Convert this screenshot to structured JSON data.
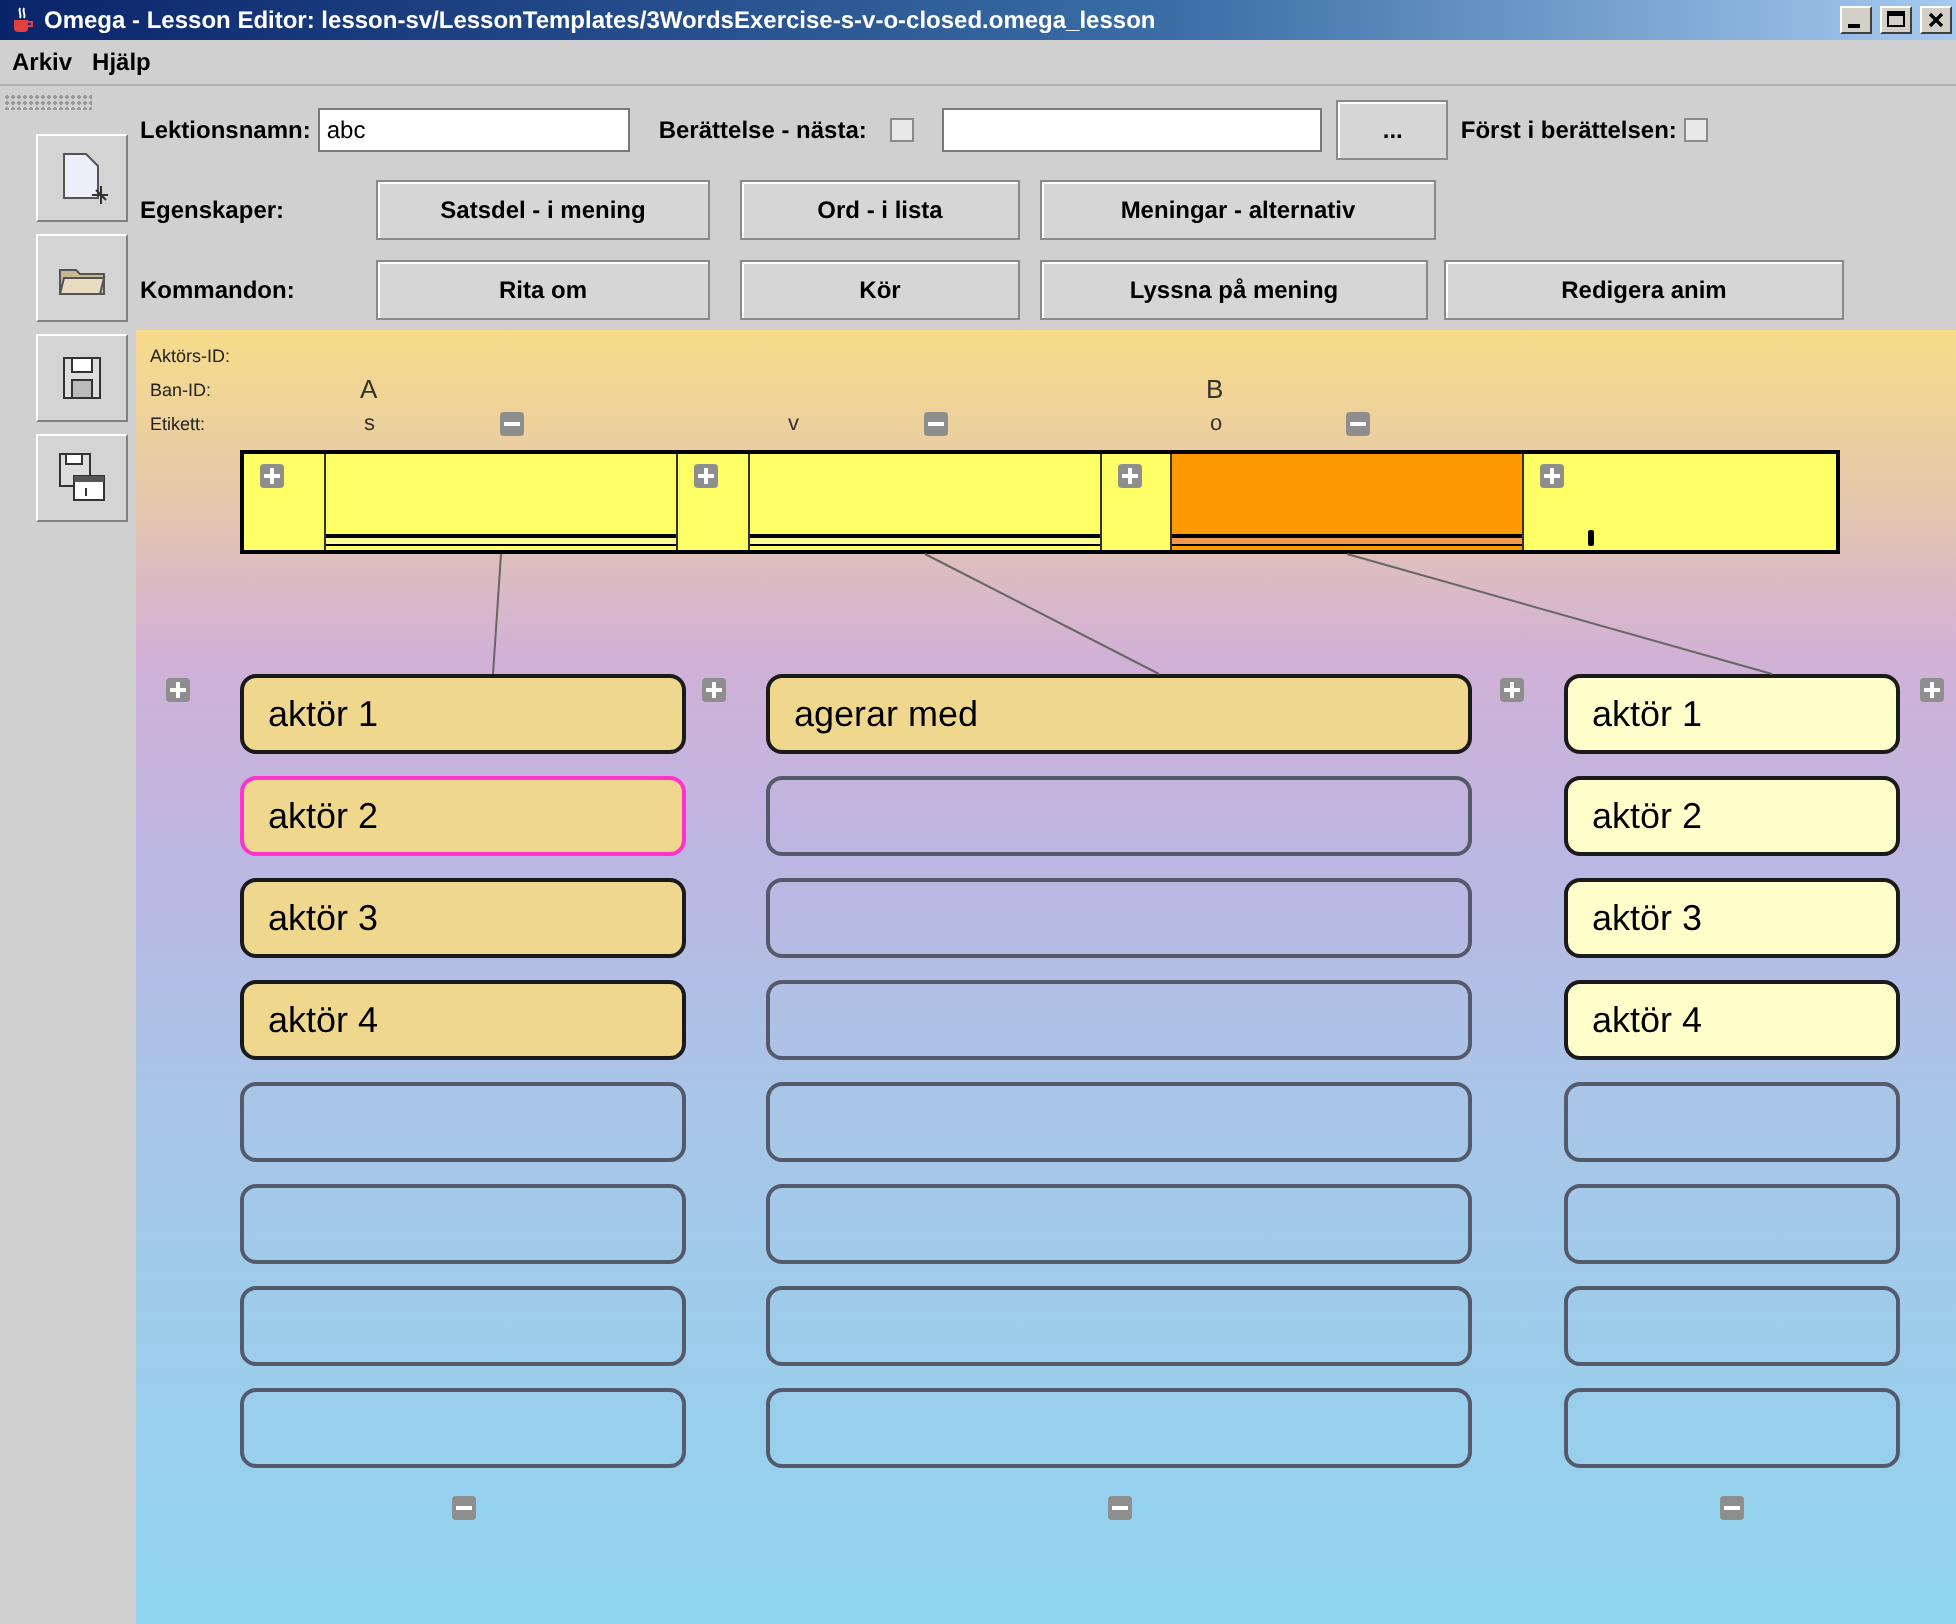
{
  "window": {
    "title": "Omega - Lesson Editor: lesson-sv/LessonTemplates/3WordsExercise-s-v-o-closed.omega_lesson"
  },
  "menu": [
    "Arkiv",
    "Hjälp"
  ],
  "form": {
    "lesson_name_label": "Lektionsnamn:",
    "lesson_name_value": "abc",
    "story_next_label": "Berättelse - nästa:",
    "story_next_checked": false,
    "browse_button": "...",
    "first_in_story_label": "Först i berättelsen:",
    "first_in_story_checked": false
  },
  "properties": {
    "label": "Egenskaper:",
    "buttons": [
      "Satsdel - i mening",
      "Ord - i lista",
      "Meningar - alternativ"
    ]
  },
  "commands": {
    "label": "Kommandon:",
    "buttons": [
      "Rita om",
      "Kör",
      "Lyssna på mening",
      "Redigera anim"
    ]
  },
  "canvas": {
    "row_labels": [
      "Aktörs-ID:",
      "Ban-ID:",
      "Etikett:"
    ],
    "slots": [
      {
        "ban_id": "A",
        "label": "s",
        "selected": false
      },
      {
        "label": "v",
        "selected": false
      },
      {
        "ban_id": "B",
        "label": "o",
        "selected": true
      }
    ],
    "columns": [
      {
        "items": [
          {
            "kind": "filled",
            "text": "aktör 1",
            "selected": false
          },
          {
            "kind": "filled",
            "text": "aktör 2",
            "selected": true
          },
          {
            "kind": "filled",
            "text": "aktör 3",
            "selected": false
          },
          {
            "kind": "filled",
            "text": "aktör 4",
            "selected": false
          },
          {
            "kind": "empty",
            "selected": false
          },
          {
            "kind": "empty",
            "selected": false
          },
          {
            "kind": "empty",
            "selected": false
          },
          {
            "kind": "empty",
            "selected": false
          }
        ]
      },
      {
        "items": [
          {
            "kind": "filled",
            "text": "agerar med",
            "selected": false
          },
          {
            "kind": "empty",
            "selected": false
          },
          {
            "kind": "empty",
            "selected": false
          },
          {
            "kind": "empty",
            "selected": false
          },
          {
            "kind": "empty",
            "selected": false
          },
          {
            "kind": "empty",
            "selected": false
          },
          {
            "kind": "empty",
            "selected": false
          },
          {
            "kind": "empty",
            "selected": false
          }
        ]
      },
      {
        "items": [
          {
            "kind": "light",
            "text": "aktör 1",
            "selected": false
          },
          {
            "kind": "light",
            "text": "aktör 2",
            "selected": false
          },
          {
            "kind": "light",
            "text": "aktör 3",
            "selected": false
          },
          {
            "kind": "light",
            "text": "aktör 4",
            "selected": false
          },
          {
            "kind": "empty",
            "selected": false
          },
          {
            "kind": "empty",
            "selected": false
          },
          {
            "kind": "empty",
            "selected": false
          },
          {
            "kind": "empty",
            "selected": false
          }
        ]
      }
    ]
  }
}
